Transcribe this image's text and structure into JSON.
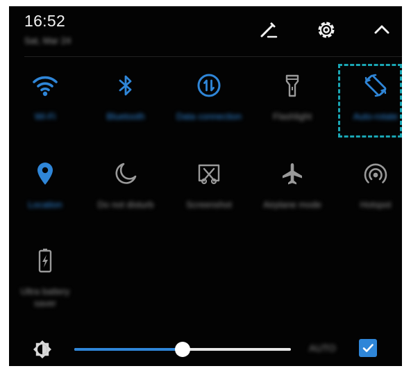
{
  "status": {
    "time": "16:52",
    "date": "Sat, Mar 24"
  },
  "header": {
    "edit_icon": "pencil-icon",
    "settings_icon": "gear-icon",
    "collapse_icon": "chevron-up-icon"
  },
  "tiles": [
    {
      "label": "Wi-Fi",
      "icon": "wifi-icon",
      "active": true
    },
    {
      "label": "Bluetooth",
      "icon": "bluetooth-icon",
      "active": true
    },
    {
      "label": "Data connection",
      "icon": "data-connection-icon",
      "active": true
    },
    {
      "label": "Flashlight",
      "icon": "flashlight-icon",
      "active": false
    },
    {
      "label": "Auto-rotate",
      "icon": "auto-rotate-icon",
      "active": true,
      "highlighted": true
    },
    {
      "label": "Location",
      "icon": "location-icon",
      "active": true
    },
    {
      "label": "Do not disturb",
      "icon": "moon-icon",
      "active": false
    },
    {
      "label": "Screenshot",
      "icon": "screenshot-icon",
      "active": false
    },
    {
      "label": "Airplane mode",
      "icon": "airplane-icon",
      "active": false
    },
    {
      "label": "Hotspot",
      "icon": "hotspot-icon",
      "active": false
    },
    {
      "label": "Ultra battery saver",
      "icon": "battery-saver-icon",
      "active": false
    }
  ],
  "brightness": {
    "icon": "brightness-icon",
    "level_percent": 50,
    "auto_label": "AUTO",
    "auto_checked": true
  },
  "colors": {
    "accent": "#2f86d8",
    "inactive": "#8d8d8d",
    "background": "#030303",
    "highlight_border": "#1aa6b4"
  }
}
